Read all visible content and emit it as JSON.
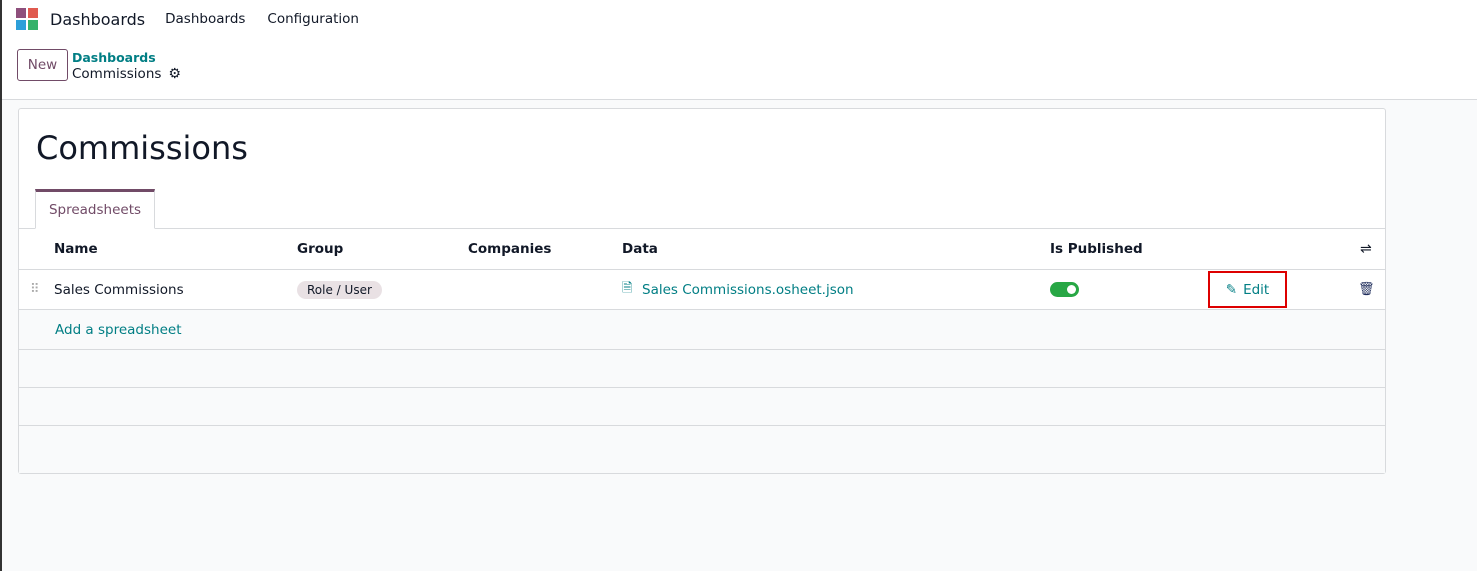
{
  "nav": {
    "brand": "Dashboards",
    "menu": [
      "Dashboards",
      "Configuration"
    ]
  },
  "control": {
    "new_label": "New",
    "breadcrumb_parent": "Dashboards",
    "breadcrumb_current": "Commissions"
  },
  "form": {
    "title": "Commissions",
    "tabs": [
      {
        "label": "Spreadsheets"
      }
    ]
  },
  "table": {
    "headers": [
      "Name",
      "Group",
      "Companies",
      "Data",
      "Is Published"
    ],
    "rows": [
      {
        "name": "Sales Commissions",
        "group": "Role / User",
        "companies": "",
        "data": "Sales Commissions.osheet.json",
        "is_published": true,
        "edit_label": "Edit"
      }
    ],
    "add_label": "Add a spreadsheet"
  }
}
